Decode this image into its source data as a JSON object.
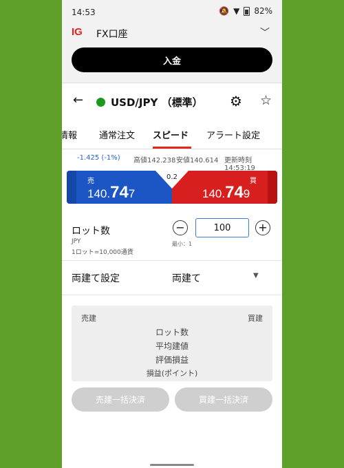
{
  "status": {
    "time": "14:53",
    "battery": "82%",
    "icons": [
      "bell-muted-icon",
      "wifi-icon",
      "battery-icon"
    ]
  },
  "account": {
    "logo": "IG",
    "name": "FX口座"
  },
  "deposit_label": "入金",
  "instrument": {
    "name": "USD/JPY （標準）",
    "status_color": "#1a9a1a"
  },
  "tabs": [
    {
      "label": "情報"
    },
    {
      "label": "通常注文"
    },
    {
      "label": "スピード",
      "active": true
    },
    {
      "label": "アラート設定"
    }
  ],
  "stats": {
    "change": "-1.425 (-1%)",
    "high": "高値142.238",
    "low": "安値140.614",
    "updated": "更新時刻14:53:19"
  },
  "quote": {
    "sell_label": "売",
    "sell_prefix": "140.",
    "sell_big": "74",
    "sell_suffix": "7",
    "buy_label": "買",
    "buy_prefix": "140.",
    "buy_big": "74",
    "buy_suffix": "9",
    "spread": "0.2",
    "colors": {
      "sell": "#1c56c4",
      "buy": "#d81f1f"
    }
  },
  "lot": {
    "label": "ロット数",
    "currency": "JPY",
    "unit_note": "1ロット=10,000通貨",
    "value": "100",
    "min_label": "最小：1"
  },
  "hedge": {
    "label": "両建て設定",
    "value": "両建て"
  },
  "positions": {
    "sell_label": "売建",
    "buy_label": "買建",
    "rows": [
      "ロット数",
      "平均建値",
      "評価損益",
      "損益(ポイント)"
    ]
  },
  "buttons": {
    "close_sell": "売建一括決済",
    "close_buy": "買建一括決済"
  }
}
